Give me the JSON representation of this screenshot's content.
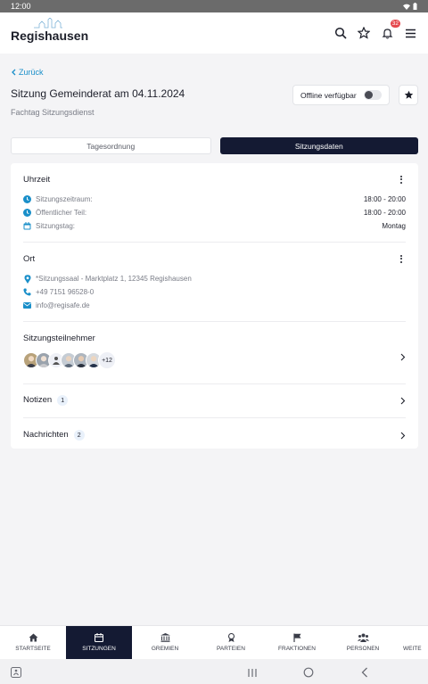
{
  "status": {
    "time": "12:00"
  },
  "app": {
    "brand": "Regishausen",
    "notifications_count": "32"
  },
  "page": {
    "back_label": "Zurück",
    "title": "Sitzung Gemeinderat am 04.11.2024",
    "subtitle": "Fachtag Sitzungsdienst",
    "offline_label": "Offline verfügbar"
  },
  "tabs": [
    {
      "label": "Tagesordnung",
      "active": false
    },
    {
      "label": "Sitzungsdaten",
      "active": true
    }
  ],
  "time_section": {
    "title": "Uhrzeit",
    "rows": [
      {
        "label": "Sitzungszeitraum:",
        "value": "18:00 - 20:00",
        "icon": "clock-icon"
      },
      {
        "label": "Öffentlicher Teil:",
        "value": "18:00 - 20:00",
        "icon": "clock-icon"
      },
      {
        "label": "Sitzungstag:",
        "value": "Montag",
        "icon": "calendar-icon"
      }
    ]
  },
  "place_section": {
    "title": "Ort",
    "address": "*Sitzungssaal - Marktplatz 1, 12345 Regishausen",
    "phone": "+49 7151 96528-0",
    "email": "info@regisafe.de"
  },
  "participants": {
    "title": "Sitzungsteilnehmer",
    "more": "+12"
  },
  "notes": {
    "label": "Notizen",
    "count": "1"
  },
  "messages": {
    "label": "Nachrichten",
    "count": "2"
  },
  "bottom_nav": [
    {
      "label": "STARTSEITE",
      "icon": "home-icon"
    },
    {
      "label": "SITZUNGEN",
      "icon": "calendar-icon",
      "active": true
    },
    {
      "label": "GREMIEN",
      "icon": "institution-icon"
    },
    {
      "label": "PARTEIEN",
      "icon": "badge-icon"
    },
    {
      "label": "FRAKTIONEN",
      "icon": "flag-icon"
    },
    {
      "label": "PERSONEN",
      "icon": "people-icon"
    },
    {
      "label": "WEITE",
      "icon": "more-icon"
    }
  ],
  "colors": {
    "accent": "#1a8fc9",
    "active_dark": "#141a33",
    "badge": "#e5484d"
  }
}
